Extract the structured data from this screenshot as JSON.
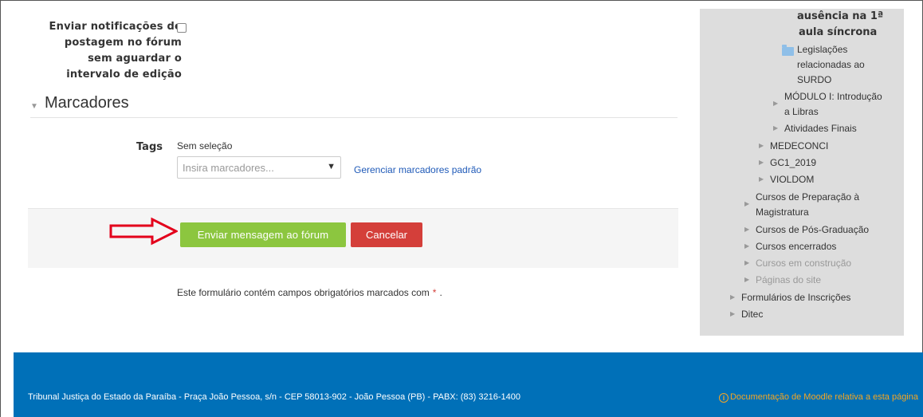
{
  "form": {
    "notify_label_lines": [
      "Enviar notificações de",
      "postagem no fórum",
      "sem aguardar o",
      "intervalo de edição"
    ],
    "section_title": "Marcadores",
    "tags_label": "Tags",
    "tags_no_selection": "Sem seleção",
    "tags_placeholder": "Insira marcadores...",
    "tags_manage_link": "Gerenciar marcadores padrão",
    "submit_label": "Enviar mensagem ao fórum",
    "cancel_label": "Cancelar",
    "required_note": "Este formulário contém campos obrigatórios marcados com",
    "required_star": "*",
    "required_end": "."
  },
  "sidebar": {
    "bold_lines": [
      "ausência na 1ª",
      "aula síncrona"
    ],
    "folder_item_lines": [
      "Legislações",
      "relacionadas ao",
      "SURDO"
    ],
    "modulo_lines": [
      "MÓDULO I: Introdução",
      "a Libras"
    ],
    "atividades": "Atividades Finais",
    "medeconci": "MEDECONCI",
    "gc1": "GC1_2019",
    "violdom": "VIOLDOM",
    "prep_lines": [
      "Cursos de Preparação à",
      "Magistratura"
    ],
    "pos": "Cursos de Pós-Graduação",
    "encerrados": "Cursos encerrados",
    "construcao": "Cursos em construção",
    "paginas": "Páginas do site",
    "formularios": "Formulários de Inscrições",
    "ditec": "Ditec"
  },
  "footer": {
    "address": "Tribunal Justiça do Estado da Paraíba - Praça João Pessoa, s/n - CEP 58013-902 - João Pessoa (PB) - PABX: (83) 3216-1400",
    "doc_link": "Documentação de Moodle relativa a esta página",
    "info_glyph": "i"
  },
  "colors": {
    "submit": "#8cc63f",
    "cancel": "#d43f3a",
    "footer": "#0070b8",
    "link": "#1f5ab8",
    "doc_link": "#f5a623",
    "sidebar_bg": "#dddddd",
    "arrow": "#e3001b"
  }
}
